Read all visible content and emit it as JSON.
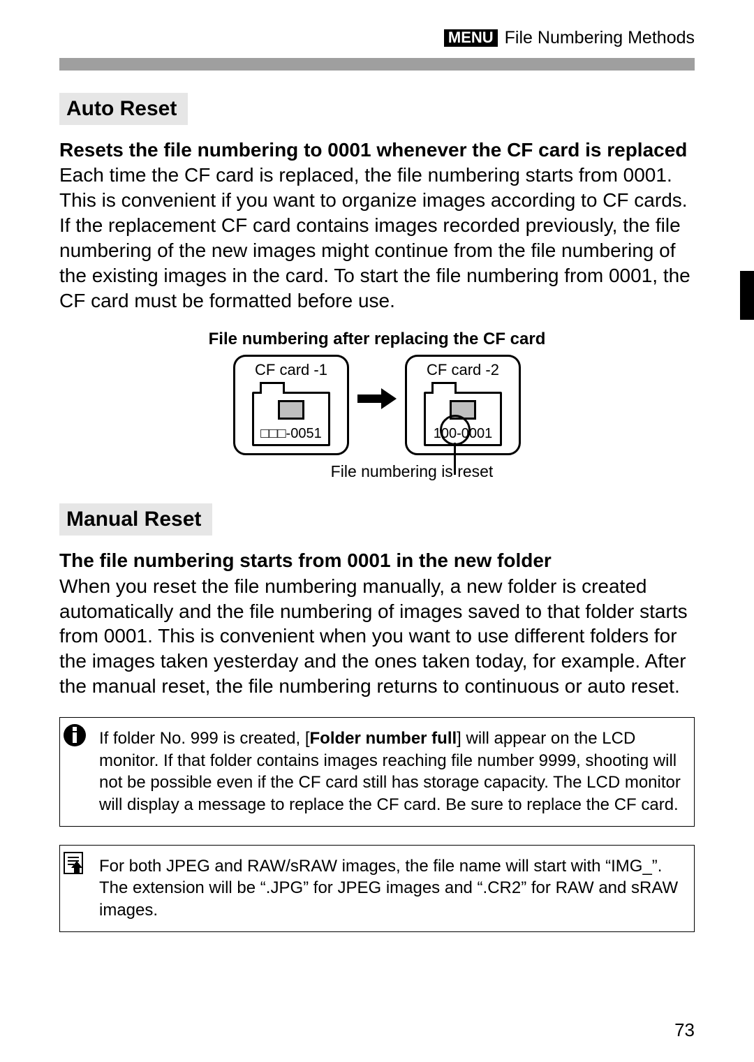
{
  "header": {
    "menu_badge": "MENU",
    "title": "File Numbering Methods"
  },
  "sections": {
    "auto_reset": {
      "heading": "Auto Reset",
      "lead": "Resets the file numbering to 0001 whenever the CF card is replaced",
      "body": "Each time the CF card is replaced, the file numbering starts from 0001. This is convenient if you want to organize images according to CF cards. If the replacement CF card contains images recorded previously, the file numbering of the new images might continue from the file numbering of the existing images in the card. To start the file numbering from 0001, the CF card must be formatted before use."
    },
    "manual_reset": {
      "heading": "Manual Reset",
      "lead": "The file numbering starts from 0001 in the new folder",
      "body": "When you reset the file numbering manually, a new folder is created automatically and the file numbering of images saved to that folder starts from 0001. This is convenient when you want to use different folders for the images taken yesterday and the ones taken today, for example. After the manual reset, the file numbering returns to continuous or auto reset."
    }
  },
  "diagram": {
    "title": "File numbering after replacing the CF card",
    "card1": {
      "label": "CF card -1",
      "file": "□□□-0051"
    },
    "card2": {
      "label": "CF card -2",
      "file": "100-0001"
    },
    "caption": "File numbering is reset"
  },
  "notes": {
    "info_pre": "If folder No. 999 is created, [",
    "info_bold": "Folder number full",
    "info_post": "] will appear on the LCD monitor. If that folder contains images reaching file number 9999, shooting will not be possible even if the CF card still has storage capacity. The LCD monitor will display a message to replace the CF card. Be sure to replace the CF card.",
    "tip": "For both JPEG and RAW/sRAW images, the file name will start with “IMG_”. The extension will be “.JPG” for JPEG images and “.CR2” for RAW and sRAW images."
  },
  "page_number": "73"
}
